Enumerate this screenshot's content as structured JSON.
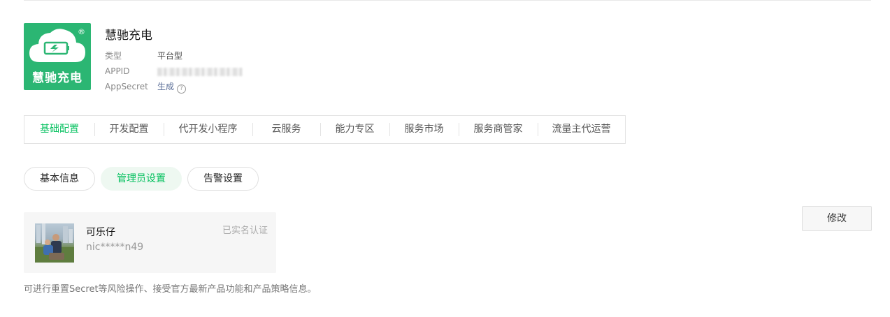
{
  "app": {
    "logo_text": "慧驰充电",
    "name": "慧驰充电",
    "type_label": "类型",
    "type_value": "平台型",
    "appid_label": "APPID",
    "secret_label": "AppSecret",
    "secret_action": "生成",
    "help": "?",
    "reg_mark": "®"
  },
  "tabs": [
    {
      "label": "基础配置",
      "active": true
    },
    {
      "label": "开发配置"
    },
    {
      "label": "代开发小程序"
    },
    {
      "label": "云服务"
    },
    {
      "label": "能力专区"
    },
    {
      "label": "服务市场"
    },
    {
      "label": "服务商管家"
    },
    {
      "label": "流量主代运营"
    }
  ],
  "subtabs": [
    {
      "label": "基本信息"
    },
    {
      "label": "管理员设置",
      "active": true
    },
    {
      "label": "告警设置"
    }
  ],
  "admin": {
    "name": "可乐仔",
    "masked_id": "nic*****n49",
    "status": "已实名认证"
  },
  "modify_button": "修改",
  "description": "可进行重置Secret等风险操作、接受官方最新产品功能和产品策略信息。",
  "colors": {
    "accent": "#07c160",
    "logo_bg": "#2bb673",
    "link": "#576b95"
  }
}
